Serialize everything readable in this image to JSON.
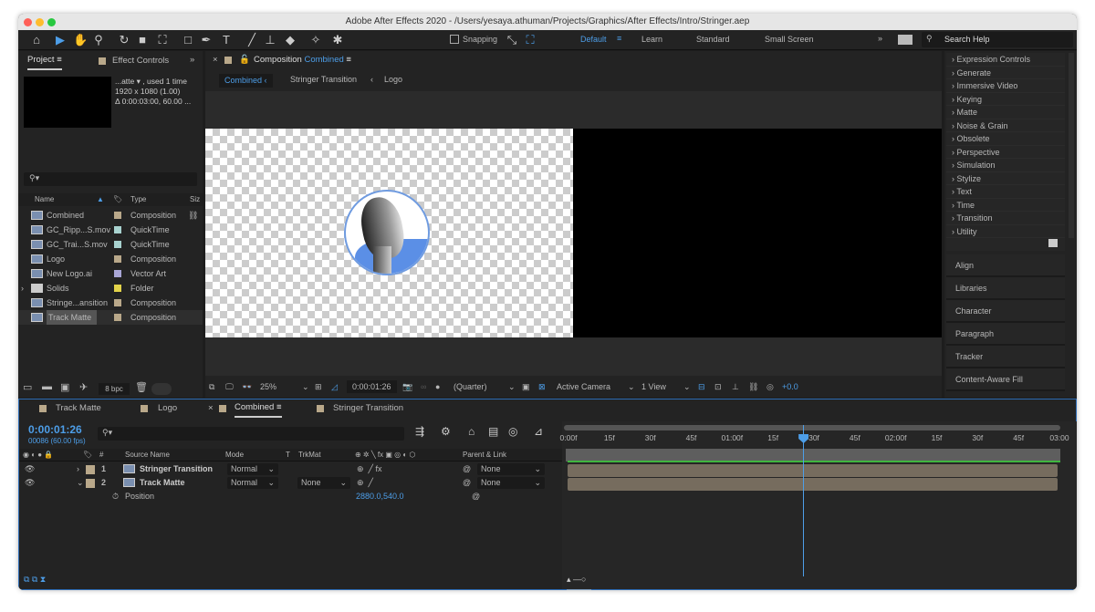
{
  "window": {
    "title": "Adobe After Effects 2020 - /Users/yesaya.athuman/Projects/Graphics/After Effects/Intro/Stringer.aep"
  },
  "toolbar": {
    "snapping": "Snapping",
    "workspaces": [
      "Default",
      "Learn",
      "Standard",
      "Small Screen"
    ],
    "search_placeholder": "Search Help",
    "overflow": "»"
  },
  "project": {
    "tab": "Project",
    "effect_controls_tab": "Effect Controls",
    "info": [
      "...atte ▾ , used 1 time",
      "1920 x 1080 (1.00)",
      "Δ 0:00:03:00, 60.00 ..."
    ],
    "columns": {
      "name": "Name",
      "type": "Type",
      "size": "Siz"
    },
    "items": [
      {
        "name": "Combined",
        "type": "Composition",
        "color": "#b9a88a"
      },
      {
        "name": "GC_Ripp...S.mov",
        "type": "QuickTime",
        "color": "#a8d2cf"
      },
      {
        "name": "GC_Trai...S.mov",
        "type": "QuickTime",
        "color": "#a8d2cf"
      },
      {
        "name": "Logo",
        "type": "Composition",
        "color": "#b9a88a"
      },
      {
        "name": "New Logo.ai",
        "type": "Vector Art",
        "color": "#a9a6d6"
      },
      {
        "name": "Solids",
        "type": "Folder",
        "color": "#e3d34a"
      },
      {
        "name": "Stringe...ansition",
        "type": "Composition",
        "color": "#b9a88a"
      },
      {
        "name": "Track Matte",
        "type": "Composition",
        "color": "#b9a88a"
      }
    ],
    "bpc": "8 bpc"
  },
  "composition": {
    "tab_prefix": "Composition",
    "tab_name": "Combined",
    "breadcrumbs": [
      "Combined",
      "Stringer Transition",
      "Logo"
    ],
    "zoom": "25%",
    "time": "0:00:01:26",
    "resolution": "(Quarter)",
    "camera": "Active Camera",
    "views": "1 View",
    "exposure": "+0.0"
  },
  "effects": [
    "Expression Controls",
    "Generate",
    "Immersive Video",
    "Keying",
    "Matte",
    "Noise & Grain",
    "Obsolete",
    "Perspective",
    "Simulation",
    "Stylize",
    "Text",
    "Time",
    "Transition",
    "Utility"
  ],
  "right_panels": [
    "Align",
    "Libraries",
    "Character",
    "Paragraph",
    "Tracker",
    "Content-Aware Fill"
  ],
  "timeline": {
    "tabs": [
      "Track Matte",
      "Logo",
      "Combined",
      "Stringer Transition"
    ],
    "current_time": "0:00:01:26",
    "frame_info": "00086 (60.00 fps)",
    "columns": {
      "num": "#",
      "source": "Source Name",
      "mode": "Mode",
      "t": "T",
      "trkmat": "TrkMat",
      "parent": "Parent & Link"
    },
    "layers": [
      {
        "num": "1",
        "name": "Stringer Transition",
        "mode": "Normal",
        "trkmat": "",
        "parent": "None"
      },
      {
        "num": "2",
        "name": "Track Matte",
        "mode": "Normal",
        "trkmat": "None",
        "parent": "None"
      }
    ],
    "property": {
      "name": "Position",
      "value": "2880.0,540.0"
    },
    "ruler": [
      "0:00f",
      "15f",
      "30f",
      "45f",
      "01:00f",
      "15f",
      "30f",
      "45f",
      "02:00f",
      "15f",
      "30f",
      "45f",
      "03:00"
    ],
    "playhead_fraction": 0.478
  }
}
